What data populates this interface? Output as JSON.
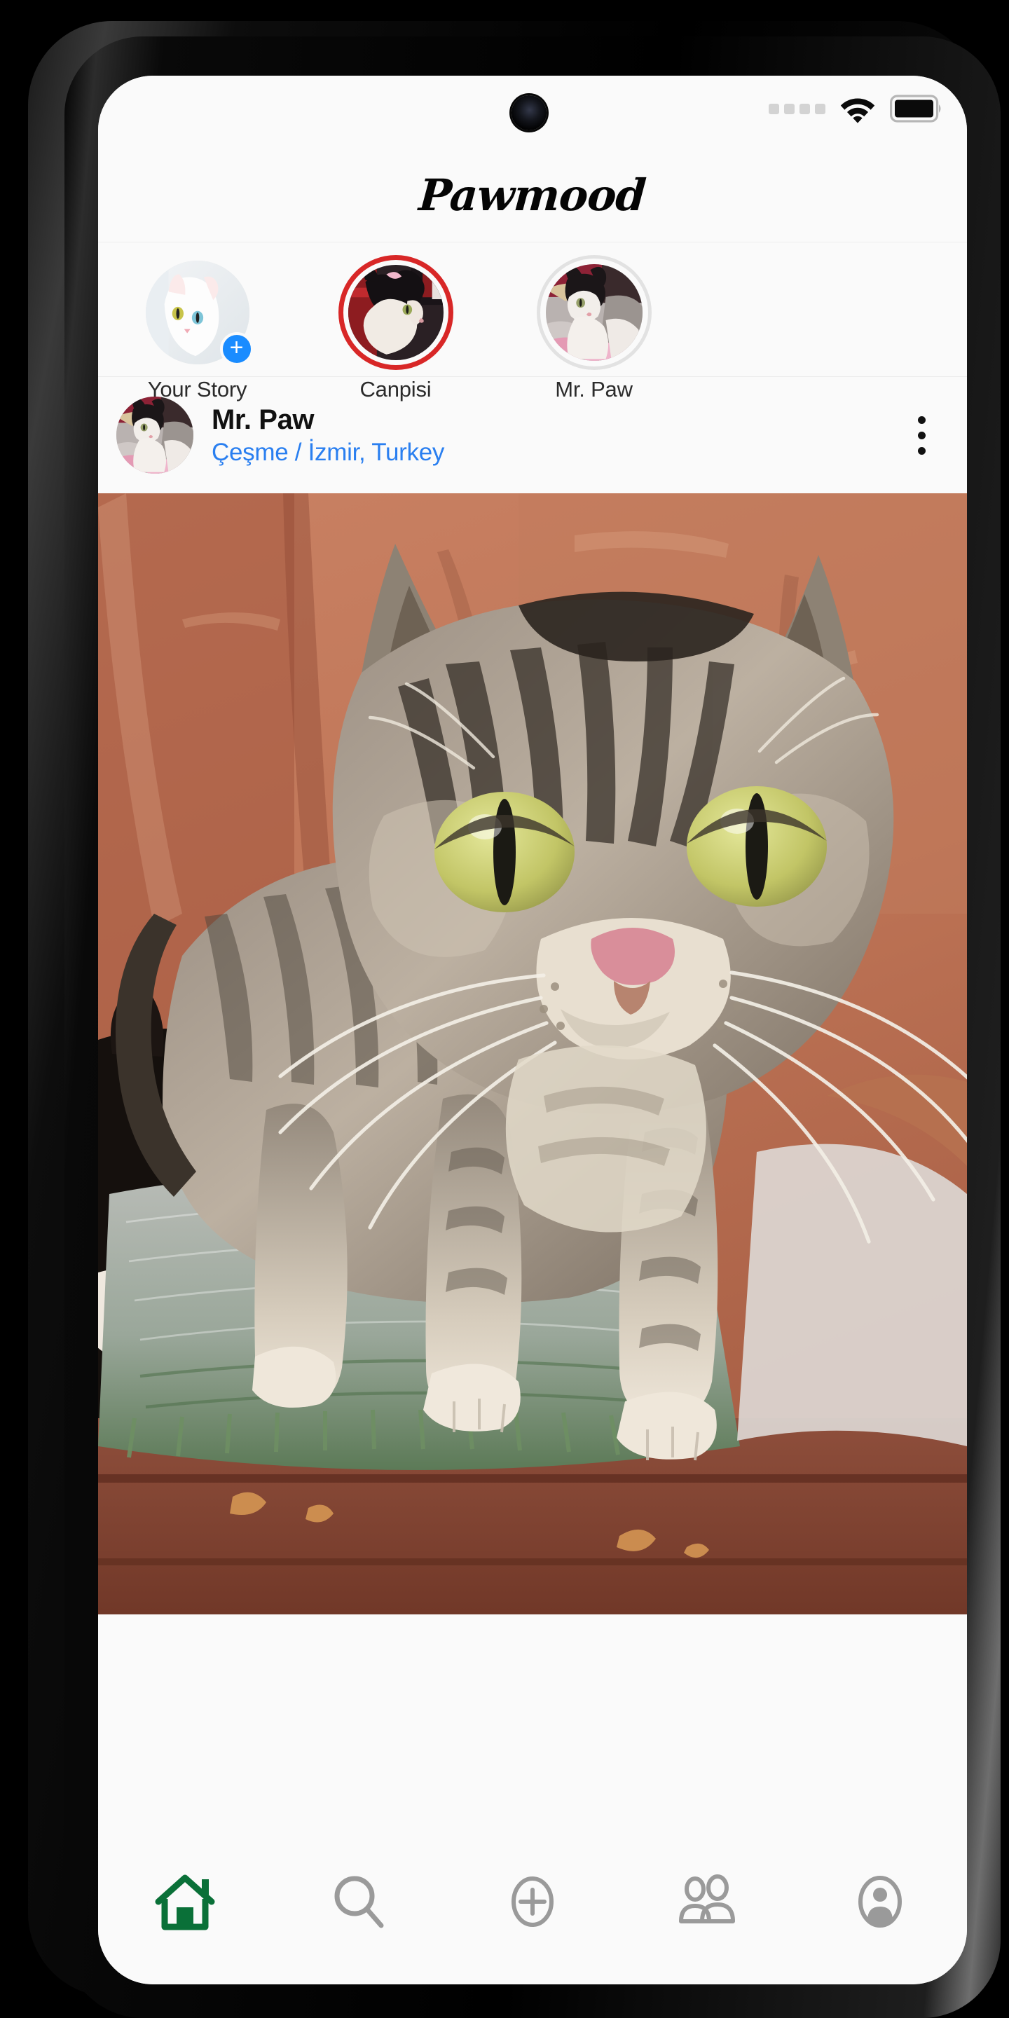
{
  "device": {
    "camera": "front-camera-punch-hole"
  },
  "statusbar": {
    "signal_dots": 4,
    "signal_icon": "signal-dots-icon",
    "wifi_icon": "wifi-icon",
    "battery_icon": "battery-full-icon",
    "battery_level": "full"
  },
  "header": {
    "app_title": "Pawmood"
  },
  "stories": {
    "items": [
      {
        "label": "Your Story",
        "ring": "none",
        "has_add_badge": true,
        "add_badge_glyph": "+",
        "avatar": "white-cat-avatar"
      },
      {
        "label": "Canpisi",
        "ring": "unseen",
        "has_add_badge": false,
        "avatar": "tuxedo-cat-avatar"
      },
      {
        "label": "Mr. Paw",
        "ring": "seen",
        "has_add_badge": false,
        "avatar": "blackwhite-cat-avatar"
      }
    ]
  },
  "post": {
    "username": "Mr. Paw",
    "location": "Çeşme / İzmir, Turkey",
    "avatar": "blackwhite-cat-avatar",
    "menu_icon": "more-vertical-icon",
    "image_alt": "tabby-cat-standing-on-doormat"
  },
  "bottom_nav": {
    "items": [
      {
        "name": "home",
        "icon": "home-icon",
        "active": true
      },
      {
        "name": "search",
        "icon": "search-icon",
        "active": false
      },
      {
        "name": "create",
        "icon": "plus-circle-icon",
        "active": false
      },
      {
        "name": "friends",
        "icon": "people-icon",
        "active": false
      },
      {
        "name": "profile",
        "icon": "profile-icon",
        "active": false
      }
    ]
  },
  "colors": {
    "accent_green": "#0a7038",
    "accent_blue": "#2a7ff0",
    "story_unseen_red": "#d82727",
    "story_seen_gray": "#e2e2e2",
    "add_badge_blue": "#1a8cff",
    "screen_bg": "#fafafa",
    "inactive_gray": "#9a9a9a"
  }
}
